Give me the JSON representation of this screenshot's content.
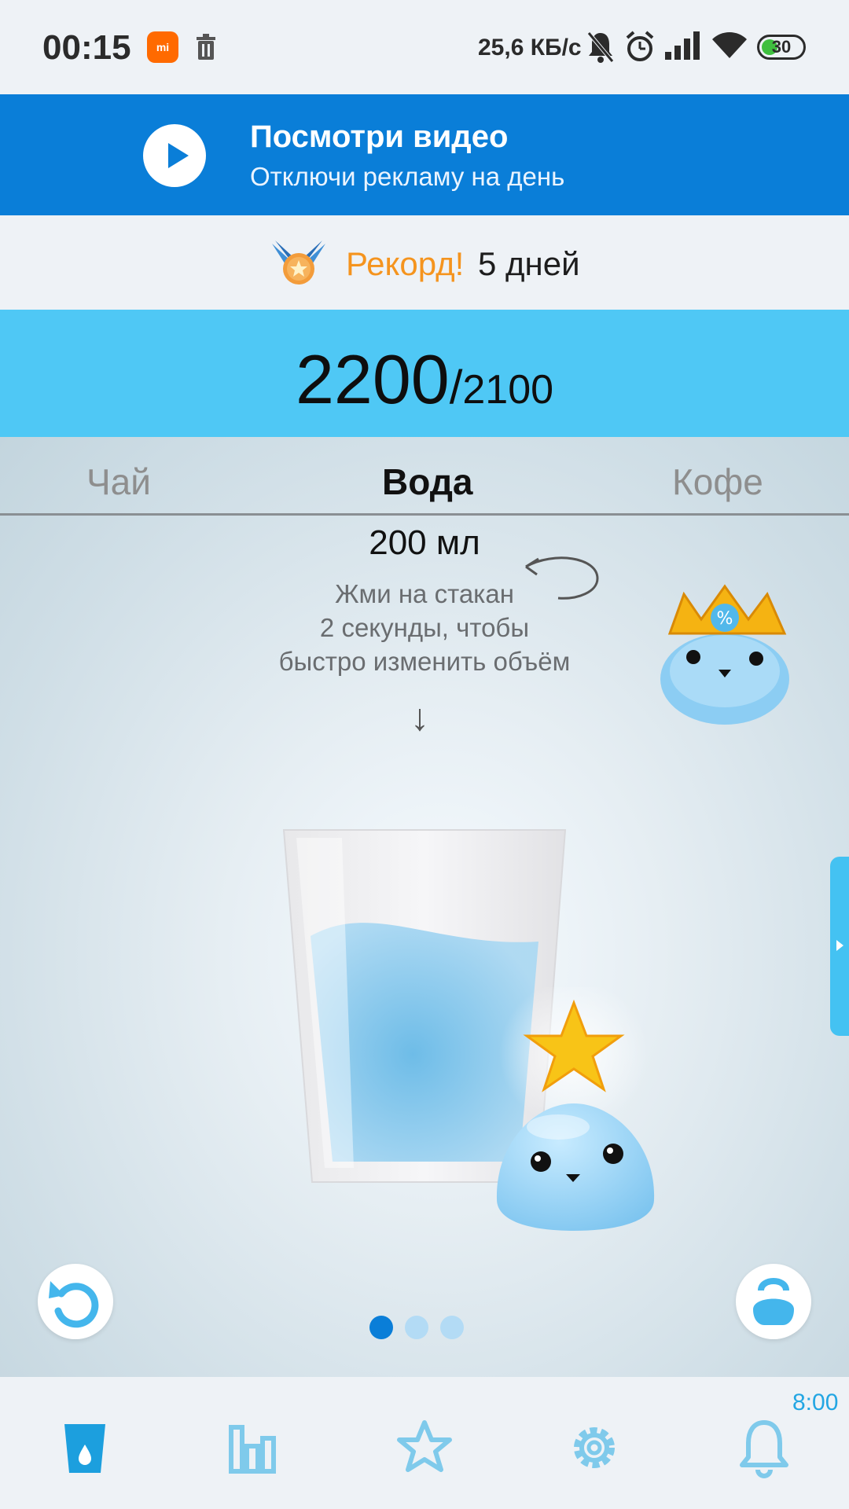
{
  "status_bar": {
    "time": "00:15",
    "net_speed": "25,6 КБ/с",
    "battery": "30",
    "icons": [
      "mi-app-icon",
      "trash-icon",
      "mute-icon",
      "alarm-icon",
      "signal-icon",
      "wifi-icon",
      "battery-icon"
    ]
  },
  "ad": {
    "title": "Посмотри видео",
    "subtitle": "Отключи рекламу на день"
  },
  "record": {
    "label": "Рекорд!",
    "days": "5 дней"
  },
  "counter": {
    "current": "2200",
    "separator": "/",
    "goal": "2100"
  },
  "tabs": [
    {
      "label": "Чай",
      "active": false
    },
    {
      "label": "Вода",
      "active": true
    },
    {
      "label": "Кофе",
      "active": false
    }
  ],
  "volume": "200 мл",
  "hint": {
    "line1": "Жми на стакан",
    "line2": "2 секунды, чтобы",
    "line3": "быстро изменить объём",
    "arrow": "↓"
  },
  "glass_fill_fraction": 0.6,
  "pager": {
    "count": 3,
    "active_index": 0
  },
  "colors": {
    "accent": "#0a7ed8",
    "counter_bg": "#4fc8f5",
    "record": "#f5941e",
    "nav_active": "#1c9fde",
    "nav_inactive": "#7fcaeb"
  },
  "bottom_nav": {
    "reminder_time": "8:00",
    "items": [
      {
        "icon": "glass-icon",
        "active": true
      },
      {
        "icon": "stats-icon",
        "active": false
      },
      {
        "icon": "star-icon",
        "active": false
      },
      {
        "icon": "gear-icon",
        "active": false
      },
      {
        "icon": "bell-icon",
        "active": false
      }
    ]
  }
}
